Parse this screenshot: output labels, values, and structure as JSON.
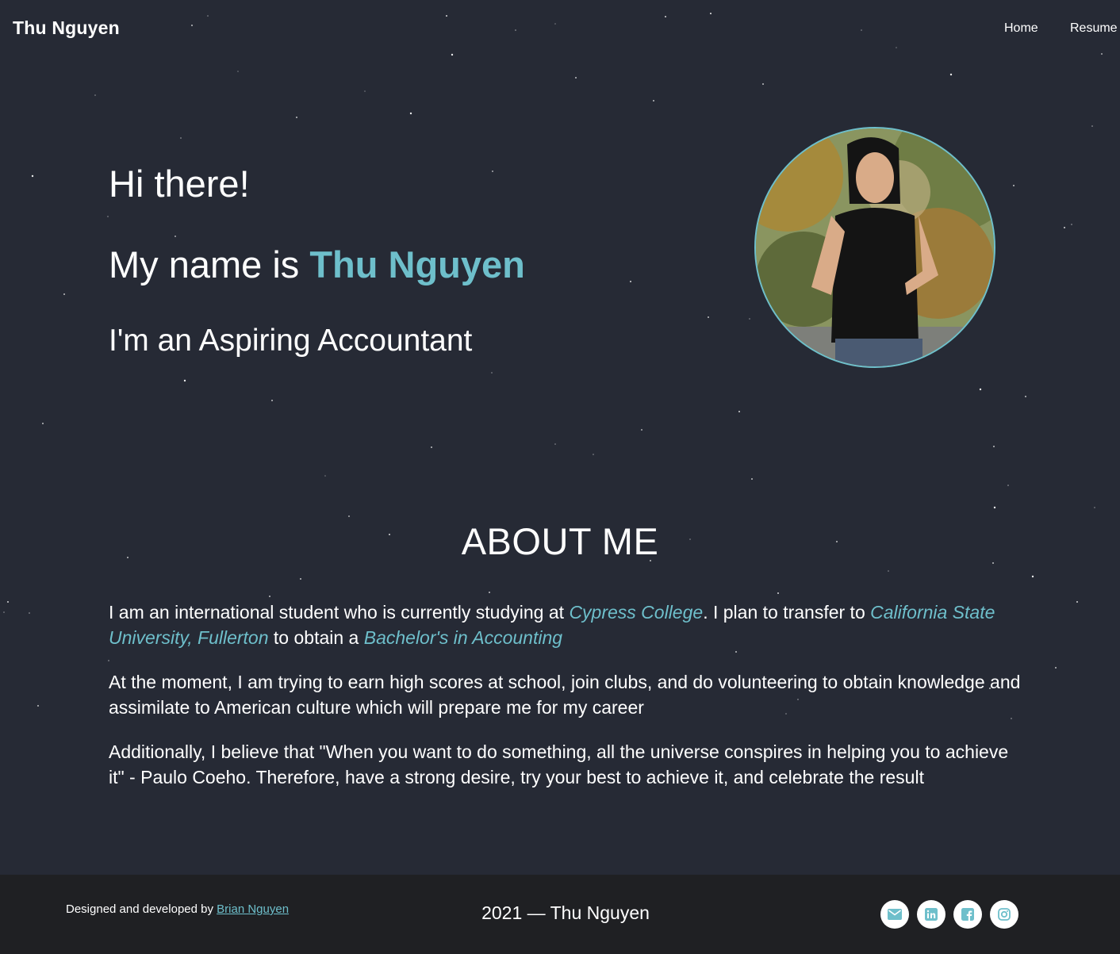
{
  "navbar": {
    "brand": "Thu Nguyen",
    "links": [
      "Home",
      "Resume"
    ]
  },
  "hero": {
    "greeting": "Hi there!",
    "name_prefix": "My name is ",
    "name": "Thu Nguyen",
    "role": "I'm an Aspiring Accountant"
  },
  "about": {
    "title": "ABOUT ME",
    "p1": {
      "t1": "I am an international student who is currently studying at ",
      "h1": "Cypress College",
      "t2": ". I plan to transfer to ",
      "h2": "California State University, Fullerton",
      "t3": " to obtain a ",
      "h3": "Bachelor's in Accounting"
    },
    "p2": "At the moment, I am trying to earn high scores at school, join clubs, and do volunteering to obtain knowledge and assimilate to American culture which will prepare me for my career",
    "p3": "Additionally, I believe that \"When you want to do something, all the universe conspires in helping you to achieve it\" - Paulo Coeho. Therefore, have a strong desire, try your best to achieve it, and celebrate the result"
  },
  "footer": {
    "credit_prefix": "Designed and developed by ",
    "credit_link": "Brian Nguyen",
    "copyright": "2021 — Thu Nguyen",
    "social_icons": [
      "mail-icon",
      "linkedin-icon",
      "facebook-icon",
      "instagram-icon"
    ]
  },
  "colors": {
    "background": "#262a35",
    "accent": "#6ebfcb",
    "footer": "#1f2023"
  }
}
